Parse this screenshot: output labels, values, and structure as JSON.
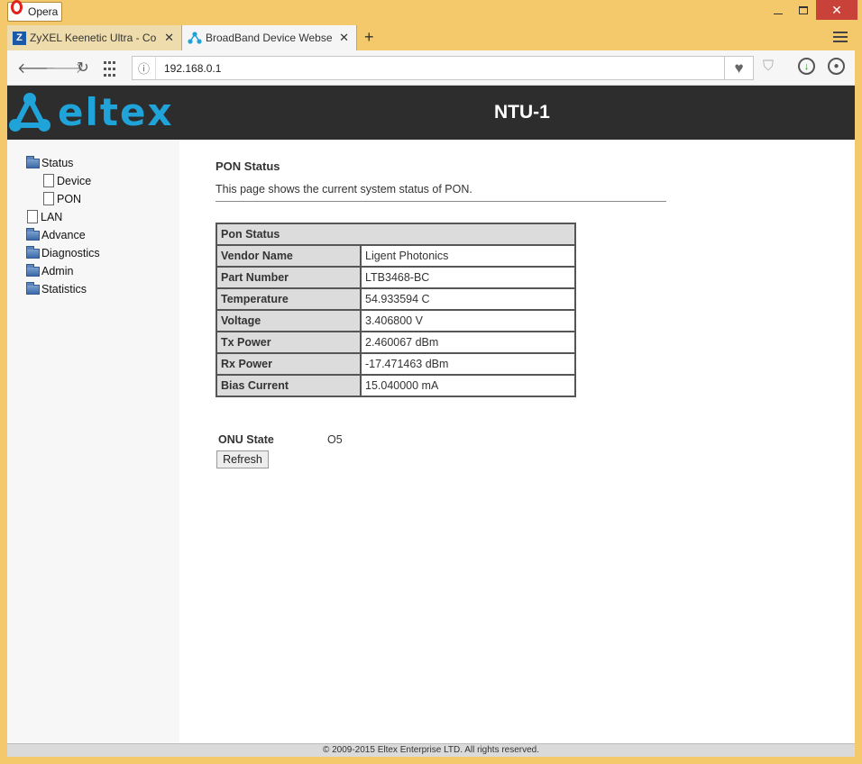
{
  "browser": {
    "app_name": "Opera",
    "tabs": [
      {
        "title": "ZyXEL Keenetic Ultra - Cor",
        "favicon": "Z"
      },
      {
        "title": "BroadBand Device Webser"
      }
    ],
    "url": "192.168.0.1"
  },
  "header": {
    "logo_text": "eltex",
    "device_name": "NTU-1"
  },
  "sidebar": {
    "items": [
      {
        "label": "Status",
        "icon": "folder-icon"
      },
      {
        "label": "Device",
        "icon": "page-icon"
      },
      {
        "label": "PON",
        "icon": "page-icon"
      },
      {
        "label": "LAN",
        "icon": "page-icon"
      },
      {
        "label": "Advance",
        "icon": "folder-icon"
      },
      {
        "label": "Diagnostics",
        "icon": "folder-icon"
      },
      {
        "label": "Admin",
        "icon": "folder-icon"
      },
      {
        "label": "Statistics",
        "icon": "folder-icon"
      }
    ]
  },
  "main": {
    "title": "PON Status",
    "description": "This page shows the current system status of PON.",
    "table_header": "Pon Status",
    "rows": [
      {
        "label": "Vendor Name",
        "value": "Ligent Photonics"
      },
      {
        "label": "Part Number",
        "value": "LTB3468-BC"
      },
      {
        "label": "Temperature",
        "value": "54.933594 C"
      },
      {
        "label": "Voltage",
        "value": "3.406800 V"
      },
      {
        "label": "Tx Power",
        "value": "2.460067 dBm"
      },
      {
        "label": "Rx Power",
        "value": "-17.471463 dBm"
      },
      {
        "label": "Bias Current",
        "value": "15.040000 mA"
      }
    ],
    "onu_state_label": "ONU State",
    "onu_state_value": "O5",
    "refresh_label": "Refresh"
  },
  "footer": {
    "text": "© 2009-2015 Eltex Enterprise LTD. All rights reserved."
  },
  "colors": {
    "brand": "#1fa3d8",
    "header_bg": "#2d2d2d",
    "window_frame": "#f3c96b"
  }
}
